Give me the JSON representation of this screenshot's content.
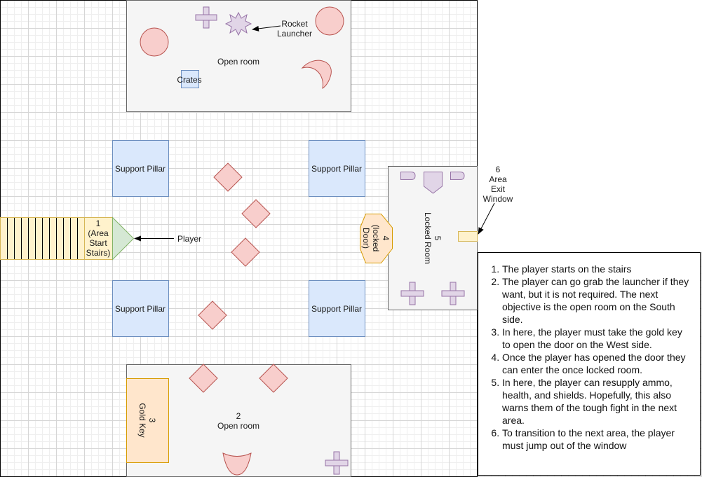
{
  "labels": {
    "rocket_launcher": "Rocket\nLauncher",
    "open_room_north": "Open room",
    "crates": "Crates",
    "support_pillar": "Support Pillar",
    "start_stairs": "1\n(Area\nStart\nStairs)",
    "player": "Player",
    "locked_door": "4\n(locked\nDoor)",
    "locked_room": "5\nLocked Room",
    "exit_window": "6\nArea\nExit\nWindow",
    "open_room_south": "2\nOpen room",
    "gold_key": "3\nGold Key"
  },
  "notes": [
    "The player starts on the stairs",
    "The player can go grab the launcher if they want, but it is not required. The next objective is the open room on the South side.",
    "In here, the player must take the gold key to open the door on the West side.",
    "Once the player has opened the door they can enter the once locked room.",
    "In here, the player can resupply ammo, health, and shields. Hopefully, this also warns them of the tough fight in the next area.",
    "To transition to the next area, the player must jump out of the window"
  ],
  "colors": {
    "room_fill": "#f5f5f5",
    "room_stroke": "#666666",
    "pillar_fill": "#dae8fc",
    "pillar_stroke": "#6c8ebf",
    "enemy_fill": "#f8cecc",
    "enemy_stroke": "#b85450",
    "pickup_fill": "#e1d5e7",
    "pickup_stroke": "#9673a6",
    "key_fill": "#ffe6cc",
    "key_stroke": "#d79b00",
    "stairs_fill": "#fff2cc",
    "stairs_stroke": "#d6b656",
    "player_fill": "#d5e8d4",
    "player_stroke": "#82b366"
  }
}
